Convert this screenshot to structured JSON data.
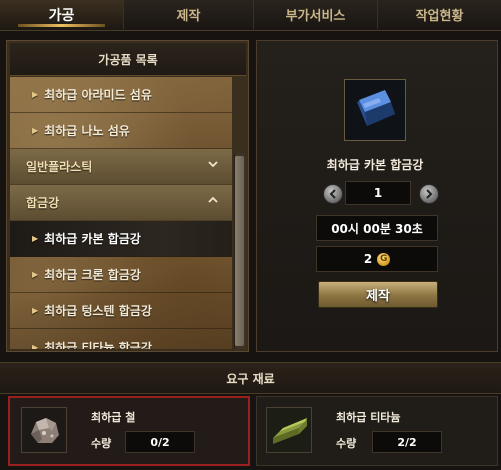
{
  "tabs": [
    {
      "label": "가공",
      "active": true
    },
    {
      "label": "제작",
      "active": false
    },
    {
      "label": "부가서비스",
      "active": false
    },
    {
      "label": "작업현황",
      "active": false
    }
  ],
  "list": {
    "title": "가공품 목록",
    "rows": [
      {
        "kind": "item",
        "label": "최하급 아라미드 섬유"
      },
      {
        "kind": "item",
        "label": "최하급 나노 섬유"
      },
      {
        "kind": "category",
        "label": "일반플라스틱",
        "expanded": false
      },
      {
        "kind": "category",
        "label": "합금강",
        "expanded": true
      },
      {
        "kind": "item",
        "label": "최하급 카본 합금강",
        "selected": true
      },
      {
        "kind": "item",
        "label": "최하급 크론 합금강"
      },
      {
        "kind": "item",
        "label": "최하급 텅스텐 합금강"
      },
      {
        "kind": "item",
        "label": "최하급 티타늄 합금강"
      }
    ]
  },
  "detail": {
    "item_name": "최하급 카본 합금강",
    "quantity": "1",
    "time": "00시 00분 30초",
    "cost": "2",
    "coin_symbol": "G",
    "craft_label": "제작"
  },
  "requirements": {
    "title": "요구 재료",
    "qty_label": "수량",
    "materials": [
      {
        "name": "최하급 철",
        "qty": "0/2",
        "sufficient": false,
        "icon": "iron-ore-icon"
      },
      {
        "name": "최하급 티타늄",
        "qty": "2/2",
        "sufficient": true,
        "icon": "titanium-bar-icon"
      }
    ]
  },
  "colors": {
    "accent_gold": "#f0c060",
    "lacking_border": "#9a2020"
  }
}
